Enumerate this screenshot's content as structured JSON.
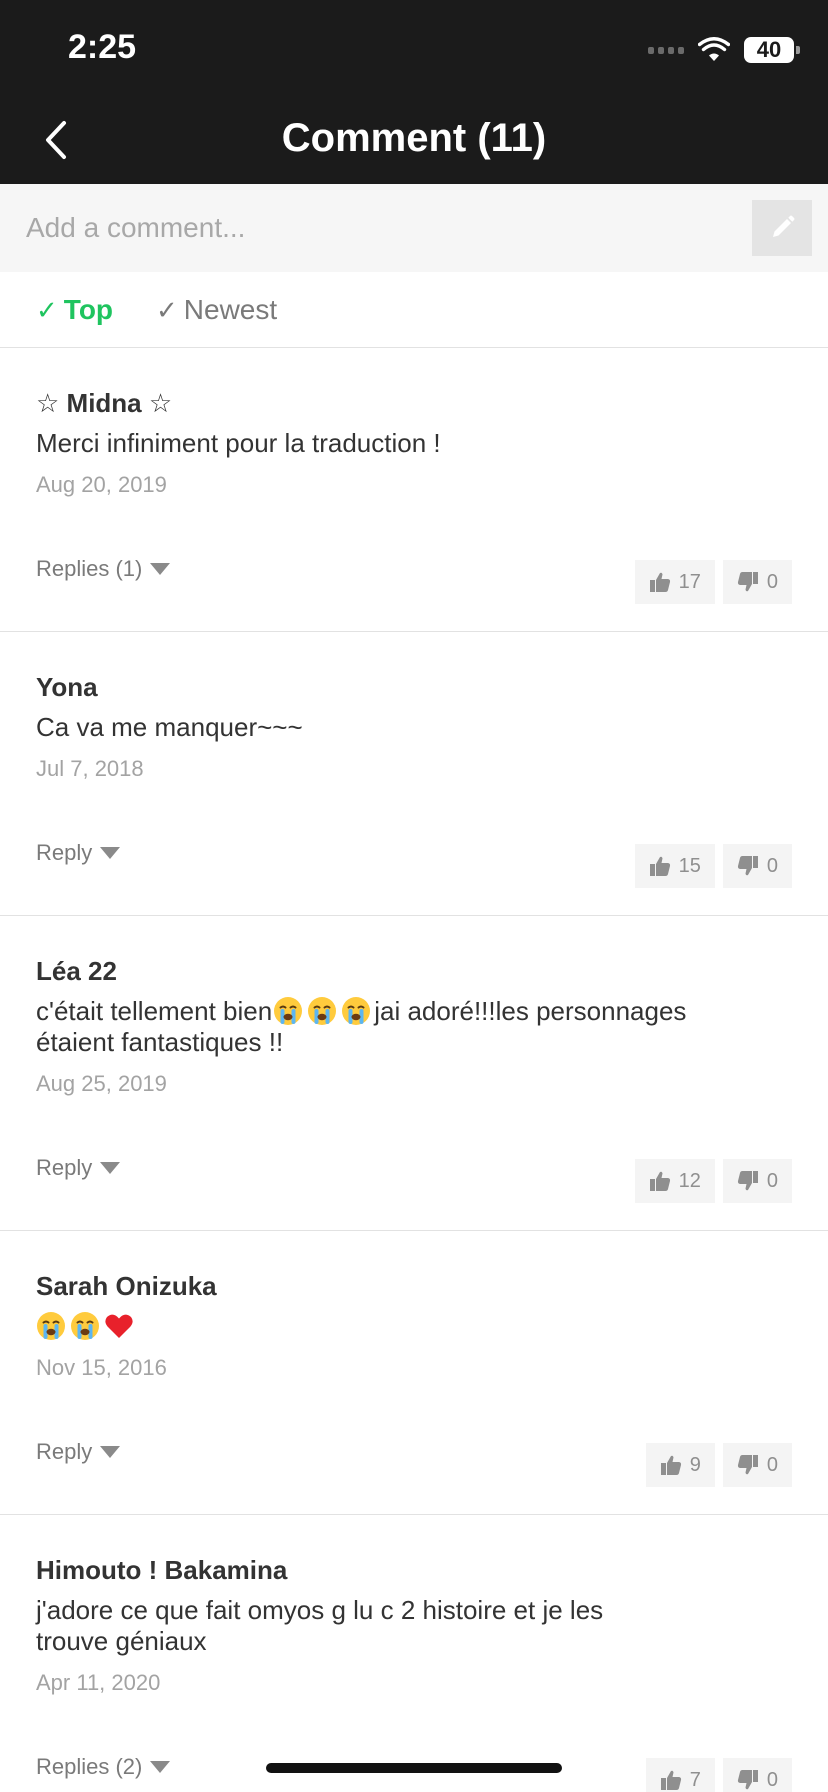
{
  "status_bar": {
    "time": "2:25",
    "battery": "40"
  },
  "header": {
    "title": "Comment (11)"
  },
  "compose": {
    "placeholder": "Add a comment..."
  },
  "tabs": [
    {
      "label": "Top",
      "active": true
    },
    {
      "label": "Newest",
      "active": false
    }
  ],
  "comments": [
    {
      "author": "☆ Midna ☆",
      "text": "Merci infiniment pour la traduction !",
      "date": "Aug 20, 2019",
      "reply_label": "Replies (1)",
      "likes": "17",
      "dislikes": "0"
    },
    {
      "author": "Yona",
      "text": "Ca va me manquer~~~",
      "date": "Jul 7, 2018",
      "reply_label": "Reply",
      "likes": "15",
      "dislikes": "0"
    },
    {
      "author": "Léa 22",
      "text_parts": [
        "c'était tellement bien",
        "jai adoré!!!les personnages",
        "étaient fantastiques !!"
      ],
      "emojis": [
        "loudly-crying-face",
        "loudly-crying-face",
        "loudly-crying-face"
      ],
      "date": "Aug 25, 2019",
      "reply_label": "Reply",
      "likes": "12",
      "dislikes": "0"
    },
    {
      "author": "Sarah Onizuka",
      "emojis": [
        "loudly-crying-face",
        "loudly-crying-face",
        "red-heart"
      ],
      "date": "Nov 15, 2016",
      "reply_label": "Reply",
      "likes": "9",
      "dislikes": "0"
    },
    {
      "author": "Himouto ! Bakamina",
      "text": "j'adore ce que fait omyos g lu c 2 histoire et je les trouve géniaux",
      "date": "Apr 11, 2020",
      "reply_label": "Replies (2)",
      "likes": "7",
      "dislikes": "0"
    }
  ],
  "colors": {
    "header_bg": "#1b1b1b",
    "active_tab": "#1fc45f",
    "inactive_tab": "#7a7a7a",
    "date_text": "#a3a3a3",
    "vote_bg": "#f4f4f4"
  }
}
